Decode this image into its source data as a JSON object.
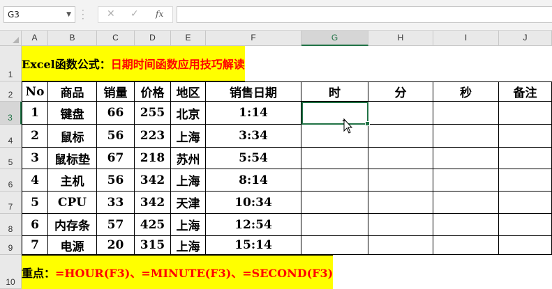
{
  "formula_bar": {
    "name_box": "G3",
    "cancel_icon": "✕",
    "enter_icon": "✓",
    "fx_label": "fx",
    "formula": ""
  },
  "columns": [
    "A",
    "B",
    "C",
    "D",
    "E",
    "F",
    "G",
    "H",
    "I",
    "J"
  ],
  "rows": [
    "1",
    "2",
    "3",
    "4",
    "5",
    "6",
    "7",
    "8",
    "9",
    "10"
  ],
  "active_cell": "G3",
  "title": {
    "prefix": "Excel函数公式：",
    "main": "日期时间函数应用技巧解读"
  },
  "headers": [
    "No",
    "商品",
    "销量",
    "价格",
    "地区",
    "销售日期",
    "时",
    "分",
    "秒",
    "备注"
  ],
  "data_rows": [
    [
      "1",
      "键盘",
      "66",
      "255",
      "北京",
      "1:14",
      "",
      "",
      "",
      ""
    ],
    [
      "2",
      "鼠标",
      "56",
      "223",
      "上海",
      "3:34",
      "",
      "",
      "",
      ""
    ],
    [
      "3",
      "鼠标垫",
      "67",
      "218",
      "苏州",
      "5:54",
      "",
      "",
      "",
      ""
    ],
    [
      "4",
      "主机",
      "56",
      "342",
      "上海",
      "8:14",
      "",
      "",
      "",
      ""
    ],
    [
      "5",
      "CPU",
      "33",
      "342",
      "天津",
      "10:34",
      "",
      "",
      "",
      ""
    ],
    [
      "6",
      "内存条",
      "57",
      "425",
      "上海",
      "12:54",
      "",
      "",
      "",
      ""
    ],
    [
      "7",
      "电源",
      "20",
      "315",
      "上海",
      "15:14",
      "",
      "",
      "",
      ""
    ]
  ],
  "footer": {
    "prefix": "重点：",
    "formulas": "=HOUR(F3)、=MINUTE(F3)、=SECOND(F3)"
  },
  "colors": {
    "banner_bg": "#ffff00",
    "accent_red": "#ff0000",
    "selection_green": "#217346"
  }
}
